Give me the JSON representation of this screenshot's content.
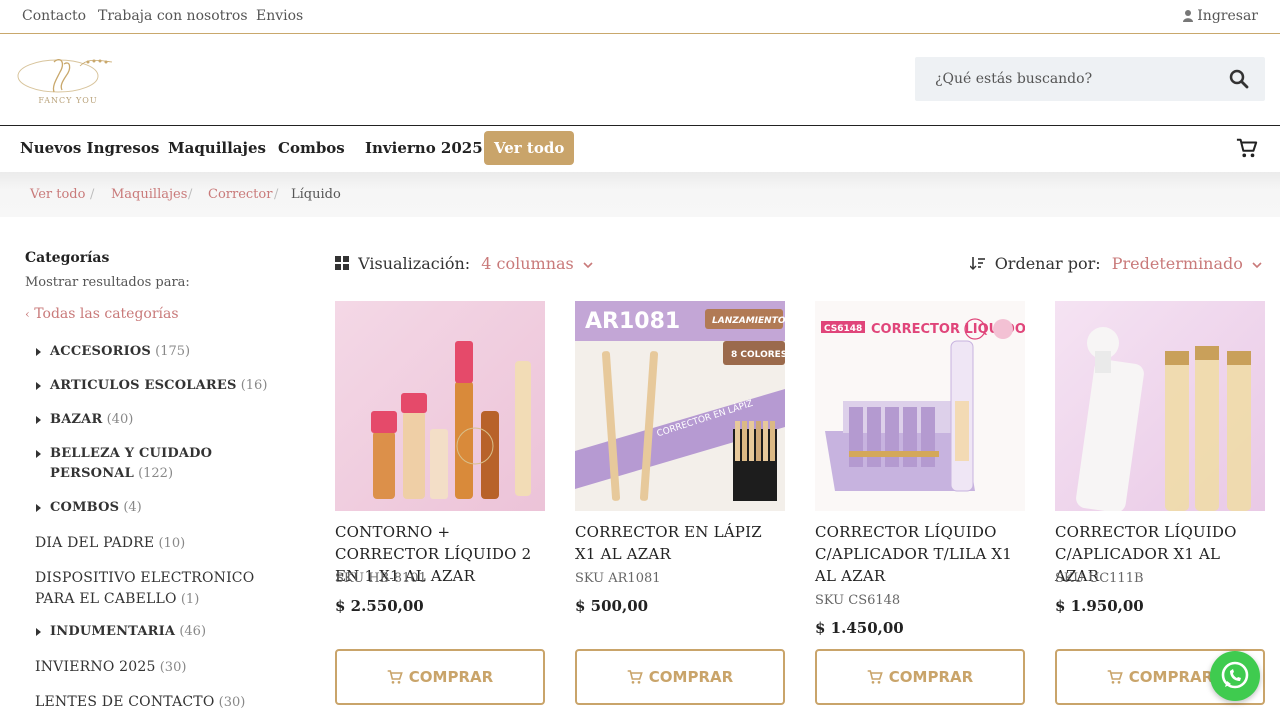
{
  "topbar": {
    "links": [
      "Contacto",
      "Trabaja con nosotros",
      "Envios"
    ],
    "login": "Ingresar"
  },
  "header": {
    "logo_text": "FANCY YOU",
    "search_placeholder": "¿Qué estás buscando?"
  },
  "nav": {
    "items": [
      "Nuevos Ingresos",
      "Maquillajes",
      "Combos",
      "Invierno 2025"
    ],
    "cta": "Ver todo"
  },
  "breadcrumb": {
    "items": [
      "Ver todo",
      "Maquillajes",
      "Corrector"
    ],
    "current": "Líquido"
  },
  "sidebar": {
    "title": "Categorías",
    "subtitle": "Mostrar resultados para:",
    "all_label": "Todas las categorías",
    "categories": [
      {
        "name": "ACCESORIOS",
        "count": "(175)"
      },
      {
        "name": "ARTICULOS ESCOLARES",
        "count": "(16)"
      },
      {
        "name": "BAZAR",
        "count": "(40)"
      },
      {
        "name": "BELLEZA Y CUIDADO PERSONAL",
        "count": "(122)"
      },
      {
        "name": "COMBOS",
        "count": "(4)"
      },
      {
        "name": "DIA DEL PADRE",
        "count": "(10)"
      },
      {
        "name": "DISPOSITIVO ELECTRONICO PARA EL CABELLO",
        "count": "(1)"
      },
      {
        "name": "INDUMENTARIA",
        "count": "(46)"
      },
      {
        "name": "INVIERNO 2025",
        "count": "(30)"
      },
      {
        "name": "LENTES DE CONTACTO",
        "count": "(30)"
      }
    ]
  },
  "toolbar": {
    "view_label": "Visualización:",
    "view_value": "4 columnas",
    "sort_label": "Ordenar por:",
    "sort_value": "Predeterminado"
  },
  "products": [
    {
      "title": "CONTORNO + CORRECTOR LÍQUIDO 2 EN 1 X1 AL AZAR",
      "sku": "SKU HB-8101",
      "price": "$  2.550,00",
      "buy": "COMPRAR"
    },
    {
      "title": "CORRECTOR EN LÁPIZ X1 AL AZAR",
      "sku": "SKU AR1081",
      "price": "$  500,00",
      "buy": "COMPRAR",
      "img_text": [
        "AR1081",
        "LANZAMIENTO",
        "8 COLORES",
        "CORRECTOR EN LÁPIZ"
      ]
    },
    {
      "title": "CORRECTOR LÍQUIDO C/APLICADOR T/LILA X1 AL AZAR",
      "sku": "SKU CS6148",
      "price": "$  1.450,00",
      "buy": "COMPRAR",
      "img_text": [
        "CS6148",
        "CORRECTOR LIQUIDO"
      ]
    },
    {
      "title": "CORRECTOR LÍQUIDO C/APLICADOR X1 AL AZAR",
      "sku": "SKU UC111B",
      "price": "$  1.950,00",
      "buy": "COMPRAR"
    }
  ],
  "colors": {
    "accent": "#c9a46a",
    "link": "#c97a7a",
    "whatsapp": "#3fcb4f"
  }
}
